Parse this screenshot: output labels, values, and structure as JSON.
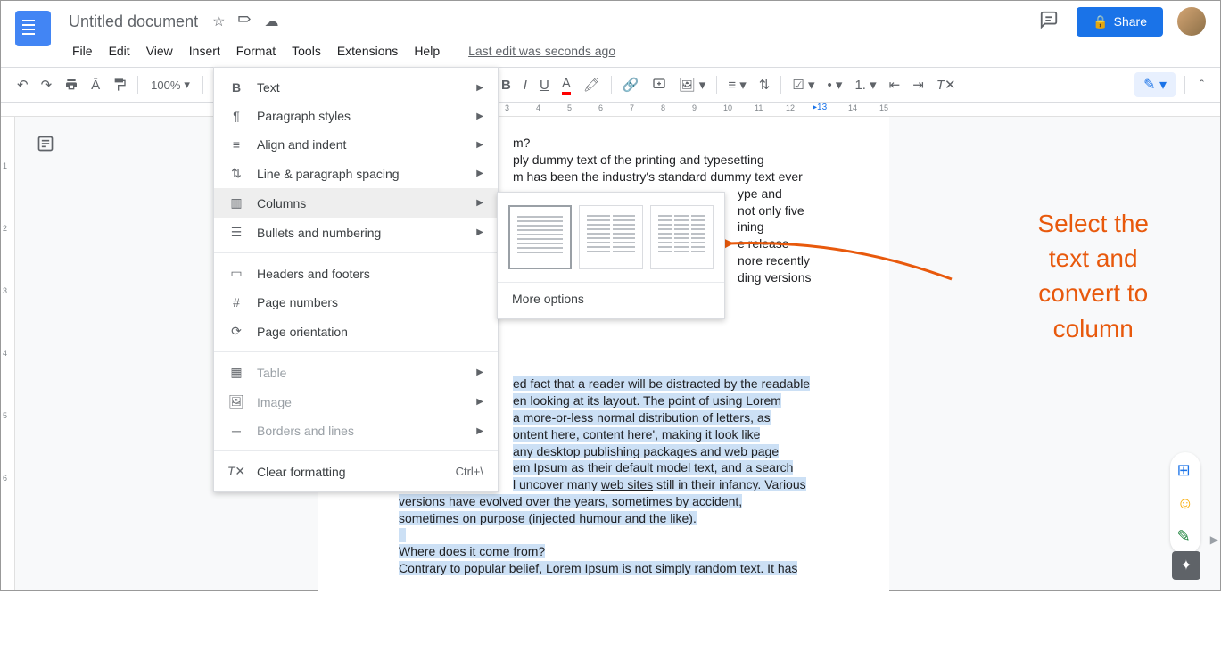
{
  "header": {
    "title": "Untitled document",
    "last_edit": "Last edit was seconds ago",
    "share_label": "Share"
  },
  "menubar": {
    "items": [
      "File",
      "Edit",
      "View",
      "Insert",
      "Format",
      "Tools",
      "Extensions",
      "Help"
    ]
  },
  "toolbar": {
    "zoom": "100%"
  },
  "format_menu": {
    "text": "Text",
    "paragraph_styles": "Paragraph styles",
    "align_indent": "Align and indent",
    "line_spacing": "Line & paragraph spacing",
    "columns": "Columns",
    "bullets_numbering": "Bullets and numbering",
    "headers_footers": "Headers and footers",
    "page_numbers": "Page numbers",
    "page_orientation": "Page orientation",
    "table": "Table",
    "image": "Image",
    "borders_lines": "Borders and lines",
    "clear_formatting": "Clear formatting",
    "clear_shortcut": "Ctrl+\\"
  },
  "columns_submenu": {
    "more_options": "More options"
  },
  "document": {
    "heading1_partial": "m?",
    "para1_l1": "ply dummy text of the printing and typesetting",
    "para1_l2": "m has been the industry's standard dummy text ever",
    "para1_l3": "ype and",
    "para1_l4": "not only five",
    "para1_l5": "ining",
    "para1_l6": "e release",
    "para1_l7": "nore recently",
    "para1_l8": "ding versions",
    "para2_l1": "ed fact that a reader will be distracted by the readable",
    "para2_l2": "en looking at its layout. The point of using Lorem",
    "para2_l3": "a more-or-less normal distribution of letters, as",
    "para2_l4": "ontent here, content here', making it look like",
    "para2_l5": "any desktop publishing packages and web page",
    "para2_l6": "em Ipsum as their default model text, and a search",
    "para2_l7_a": "l uncover many ",
    "para2_l7_b": "web sites",
    "para2_l7_c": " still in their infancy. Various",
    "para2_l8": "versions have evolved over the years, sometimes by accident,",
    "para2_l9": "sometimes on purpose (injected humour and the like).",
    "heading2": "Where does it come from?",
    "para3_l1": "Contrary to popular belief, Lorem Ipsum is not simply random text. It has"
  },
  "ruler": {
    "nums": [
      "1",
      "2",
      "3",
      "4",
      "5",
      "6",
      "7",
      "8",
      "9",
      "10",
      "11",
      "12",
      "13",
      "14",
      "15",
      "1",
      "2",
      "3",
      "4",
      "5",
      "6"
    ],
    "marker": "13"
  },
  "annotation": {
    "line1": "Select the",
    "line2": "text and",
    "line3": "convert to",
    "line4": "column"
  }
}
